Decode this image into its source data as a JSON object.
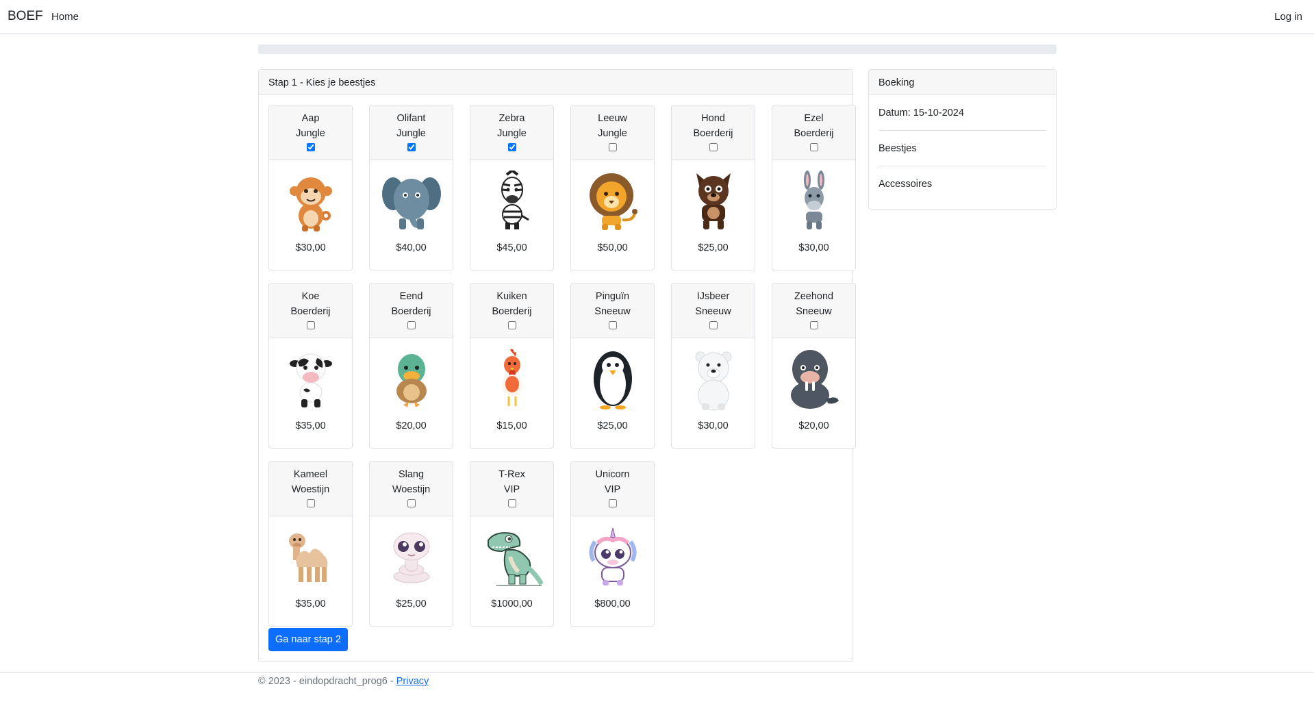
{
  "navbar": {
    "brand": "BOEF",
    "home": "Home",
    "login": "Log in"
  },
  "progress": {
    "percent": 0
  },
  "step": {
    "header": "Stap 1 - Kies je beestjes",
    "next_button": "Ga naar stap 2"
  },
  "animals": [
    {
      "name": "Aap",
      "category": "Jungle",
      "price": "$30,00",
      "checked": true,
      "icon": "monkey-icon"
    },
    {
      "name": "Olifant",
      "category": "Jungle",
      "price": "$40,00",
      "checked": true,
      "icon": "elephant-icon"
    },
    {
      "name": "Zebra",
      "category": "Jungle",
      "price": "$45,00",
      "checked": true,
      "icon": "zebra-icon"
    },
    {
      "name": "Leeuw",
      "category": "Jungle",
      "price": "$50,00",
      "checked": false,
      "icon": "lion-icon"
    },
    {
      "name": "Hond",
      "category": "Boerderij",
      "price": "$25,00",
      "checked": false,
      "icon": "dog-icon"
    },
    {
      "name": "Ezel",
      "category": "Boerderij",
      "price": "$30,00",
      "checked": false,
      "icon": "donkey-icon"
    },
    {
      "name": "Koe",
      "category": "Boerderij",
      "price": "$35,00",
      "checked": false,
      "icon": "cow-icon"
    },
    {
      "name": "Eend",
      "category": "Boerderij",
      "price": "$20,00",
      "checked": false,
      "icon": "duck-icon"
    },
    {
      "name": "Kuiken",
      "category": "Boerderij",
      "price": "$15,00",
      "checked": false,
      "icon": "chicken-icon"
    },
    {
      "name": "Pinguïn",
      "category": "Sneeuw",
      "price": "$25,00",
      "checked": false,
      "icon": "penguin-icon"
    },
    {
      "name": "IJsbeer",
      "category": "Sneeuw",
      "price": "$30,00",
      "checked": false,
      "icon": "polar-bear-icon"
    },
    {
      "name": "Zeehond",
      "category": "Sneeuw",
      "price": "$20,00",
      "checked": false,
      "icon": "seal-icon"
    },
    {
      "name": "Kameel",
      "category": "Woestijn",
      "price": "$35,00",
      "checked": false,
      "icon": "camel-icon"
    },
    {
      "name": "Slang",
      "category": "Woestijn",
      "price": "$25,00",
      "checked": false,
      "icon": "snake-icon"
    },
    {
      "name": "T-Rex",
      "category": "VIP",
      "price": "$1000,00",
      "checked": false,
      "icon": "trex-icon"
    },
    {
      "name": "Unicorn",
      "category": "VIP",
      "price": "$800,00",
      "checked": false,
      "icon": "unicorn-icon"
    }
  ],
  "booking": {
    "header": "Boeking",
    "date": "Datum: 15-10-2024",
    "animals_label": "Beestjes",
    "accessories_label": "Accessoires"
  },
  "footer": {
    "text": "© 2023 - eindopdracht_prog6 - ",
    "privacy": "Privacy"
  },
  "colors": {
    "primary": "#0d6efd",
    "muted": "#6c757d",
    "border": "#dee2e6"
  }
}
